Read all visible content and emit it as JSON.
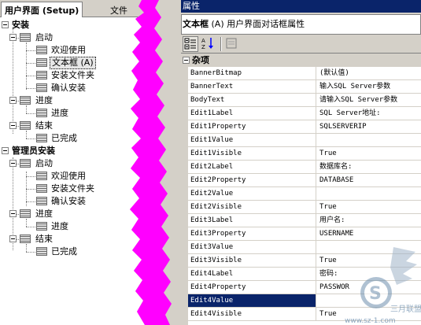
{
  "left_pane": {
    "tabs": [
      {
        "label": "用户界面 (Setup)"
      },
      {
        "label": "文件"
      }
    ],
    "tree": [
      {
        "label": "安装"
      },
      {
        "label": "启动"
      },
      {
        "label": "欢迎使用"
      },
      {
        "label": "文本框  (A)"
      },
      {
        "label": "安装文件夹"
      },
      {
        "label": "确认安装"
      },
      {
        "label": "进度"
      },
      {
        "label": "进度"
      },
      {
        "label": "结束"
      },
      {
        "label": "已完成"
      },
      {
        "label": "管理员安装"
      },
      {
        "label": "启动"
      },
      {
        "label": "欢迎使用"
      },
      {
        "label": "安装文件夹"
      },
      {
        "label": "确认安装"
      },
      {
        "label": "进度"
      },
      {
        "label": "进度"
      },
      {
        "label": "结束"
      },
      {
        "label": "已完成"
      }
    ]
  },
  "properties": {
    "title": "属性",
    "object_name": "文本框",
    "object_desc": "  (A) 用户界面对话框属性",
    "category": "杂项",
    "rows": [
      {
        "name": "BannerBitmap",
        "value": "(默认值)"
      },
      {
        "name": "BannerText",
        "value": "输入SQL Server参数"
      },
      {
        "name": "BodyText",
        "value": "请输入SQL Server参数"
      },
      {
        "name": "Edit1Label",
        "value": "SQL Server地址:"
      },
      {
        "name": "Edit1Property",
        "value": "SQLSERVERIP"
      },
      {
        "name": "Edit1Value",
        "value": ""
      },
      {
        "name": "Edit1Visible",
        "value": "True"
      },
      {
        "name": "Edit2Label",
        "value": "数据库名:"
      },
      {
        "name": "Edit2Property",
        "value": "DATABASE"
      },
      {
        "name": "Edit2Value",
        "value": ""
      },
      {
        "name": "Edit2Visible",
        "value": "True"
      },
      {
        "name": "Edit3Label",
        "value": "用户名:"
      },
      {
        "name": "Edit3Property",
        "value": "USERNAME"
      },
      {
        "name": "Edit3Value",
        "value": ""
      },
      {
        "name": "Edit3Visible",
        "value": "True"
      },
      {
        "name": "Edit4Label",
        "value": "密码:"
      },
      {
        "name": "Edit4Property",
        "value": "PASSWOR"
      },
      {
        "name": "Edit4Value",
        "value": ""
      },
      {
        "name": "Edit4Visible",
        "value": "True"
      }
    ]
  },
  "watermark": {
    "site": "www.sz-1.com",
    "brand": "三月联盟"
  },
  "colors": {
    "title_bar": "#0a246a",
    "selection": "#0a246a",
    "chrome": "#d4d0c8",
    "tear": "#ff00ff"
  }
}
